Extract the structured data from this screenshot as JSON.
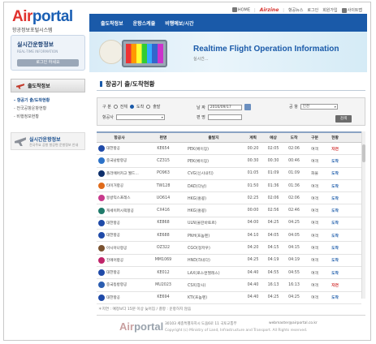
{
  "logo": {
    "brand_a": "Air",
    "brand_b": "portal",
    "subtitle": "항공정보포털시스템"
  },
  "topnav": [
    {
      "label": "HOME",
      "icon": "home-icon"
    },
    {
      "label": "Airzine",
      "brand": true
    },
    {
      "label": "항공뉴스"
    },
    {
      "label": "로그인"
    },
    {
      "label": "회원가입"
    },
    {
      "label": "사이트맵"
    }
  ],
  "gnb": {
    "items": [
      "출도착정보",
      "운항스케줄",
      "비행예보/시간"
    ]
  },
  "login_box": {
    "title": "실시간운항정보",
    "title_en": "REAL-TIME INFORMATION",
    "button": "로그인 하세요"
  },
  "banner": {
    "title_en": "Realtime Flight Operation Information",
    "title_ko": "실시간..."
  },
  "lnb": {
    "head": "출도착정보",
    "items": [
      "- 항공기 출/도착현황",
      "- 전국공항운항현황",
      "- 비행정보현황"
    ],
    "realtime_title": "실시간운항정보",
    "realtime_sub": "전국주요 공항 항공편 운항정보 안내"
  },
  "page": {
    "title": "항공기 출/도착현황"
  },
  "search": {
    "type_label": "구  분",
    "options": [
      "전체",
      "도착",
      "출발"
    ],
    "selected_option": "도착",
    "airline_label": "항공사",
    "airline_value": "",
    "date_label": "날  짜",
    "date_value": "2016/09/17",
    "flight_label": "편  명",
    "flight_value": "",
    "airport_label": "공  항",
    "airport_value": "인천",
    "button": "검색"
  },
  "table": {
    "headers": [
      "항공사",
      "편명",
      "출발지",
      "계획",
      "예상",
      "도착",
      "구분",
      "현황"
    ],
    "rows": [
      {
        "airline": "대한항공",
        "flight": "KE654",
        "origin": "PEK(베이징)",
        "plan": "00:20",
        "est": "02:05",
        "actual": "02:06",
        "type": "여객",
        "status": "지연",
        "status_color": "red",
        "logo": "#1f4aa8"
      },
      {
        "airline": "중국남방항공",
        "flight": "CZ315",
        "origin": "PEK(베이징)",
        "plan": "00:30",
        "est": "00:30",
        "actual": "00:46",
        "type": "여객",
        "status": "도착",
        "status_color": "blue",
        "logo": "#2c72c8"
      },
      {
        "airline": "폴라에어카고 월드와이드",
        "flight": "PO963",
        "origin": "CVG(신시내티)",
        "plan": "01:05",
        "est": "01:09",
        "actual": "01:09",
        "type": "화물",
        "status": "도착",
        "status_color": "blue",
        "logo": "#0d2f6b"
      },
      {
        "airline": "타이거항공",
        "flight": "TW128",
        "origin": "DAD(다낭)",
        "plan": "01:50",
        "est": "01:36",
        "actual": "01:36",
        "type": "여객",
        "status": "도착",
        "status_color": "blue",
        "logo": "#e06b1b"
      },
      {
        "airline": "동방익스프레스",
        "flight": "UO614",
        "origin": "HKG(홍콩)",
        "plan": "02:25",
        "est": "02:06",
        "actual": "02:06",
        "type": "여객",
        "status": "도착",
        "status_color": "blue",
        "logo": "#c83a8c"
      },
      {
        "airline": "캐세이퍼시픽항공",
        "flight": "CX416",
        "origin": "HKG(홍콩)",
        "plan": "00:00",
        "est": "02:56",
        "actual": "02:46",
        "type": "여객",
        "status": "도착",
        "status_color": "blue",
        "logo": "#1f7a6a"
      },
      {
        "airline": "대한항공",
        "flight": "KE868",
        "origin": "ULN(울란바토르)",
        "plan": "04:00",
        "est": "04:25",
        "actual": "04:25",
        "type": "여객",
        "status": "도착",
        "status_color": "blue",
        "logo": "#1f4aa8"
      },
      {
        "airline": "대한항공",
        "flight": "KE688",
        "origin": "PNH(프놈펜)",
        "plan": "04:10",
        "est": "04:05",
        "actual": "04:05",
        "type": "여객",
        "status": "도착",
        "status_color": "blue",
        "logo": "#1f4aa8"
      },
      {
        "airline": "아시아나항공",
        "flight": "OZ322",
        "origin": "CGO(정저우)",
        "plan": "04:20",
        "est": "04:15",
        "actual": "04:15",
        "type": "여객",
        "status": "도착",
        "status_color": "blue",
        "logo": "#7a5230"
      },
      {
        "airline": "진에어항공",
        "flight": "MM1069",
        "origin": "HND(하네다)",
        "plan": "04:25",
        "est": "04:19",
        "actual": "04:19",
        "type": "여객",
        "status": "도착",
        "status_color": "blue",
        "logo": "#c0246a"
      },
      {
        "airline": "대한항공",
        "flight": "KE012",
        "origin": "LAX(로스앤젤레스)",
        "plan": "04:40",
        "est": "04:55",
        "actual": "04:55",
        "type": "여객",
        "status": "도착",
        "status_color": "blue",
        "logo": "#1f4aa8"
      },
      {
        "airline": "중국동방항공",
        "flight": "MU2023",
        "origin": "CSX(창사)",
        "plan": "04:40",
        "est": "16:13",
        "actual": "16:13",
        "type": "여객",
        "status": "지연",
        "status_color": "red",
        "logo": "#2a5db0"
      },
      {
        "airline": "대한항공",
        "flight": "KE694",
        "origin": "KTI(프놈펜)",
        "plan": "04:40",
        "est": "04:25",
        "actual": "04:25",
        "type": "여객",
        "status": "도착",
        "status_color": "blue",
        "logo": "#1f4aa8"
      }
    ]
  },
  "legend": "＊지연 : 예정보다 15분 이상 늦어짐 / 결항 : 운항하지 않음",
  "footer": {
    "logo_a": "Air",
    "logo_b": "portal",
    "address": "30103 세종특별자치시 도움6로 11 국토교통부",
    "email": "webmaster@airportal.co.kr",
    "copyright": "Copyright (c) Ministry of Land, Infrastructure and Transport. All Rights reserved."
  }
}
